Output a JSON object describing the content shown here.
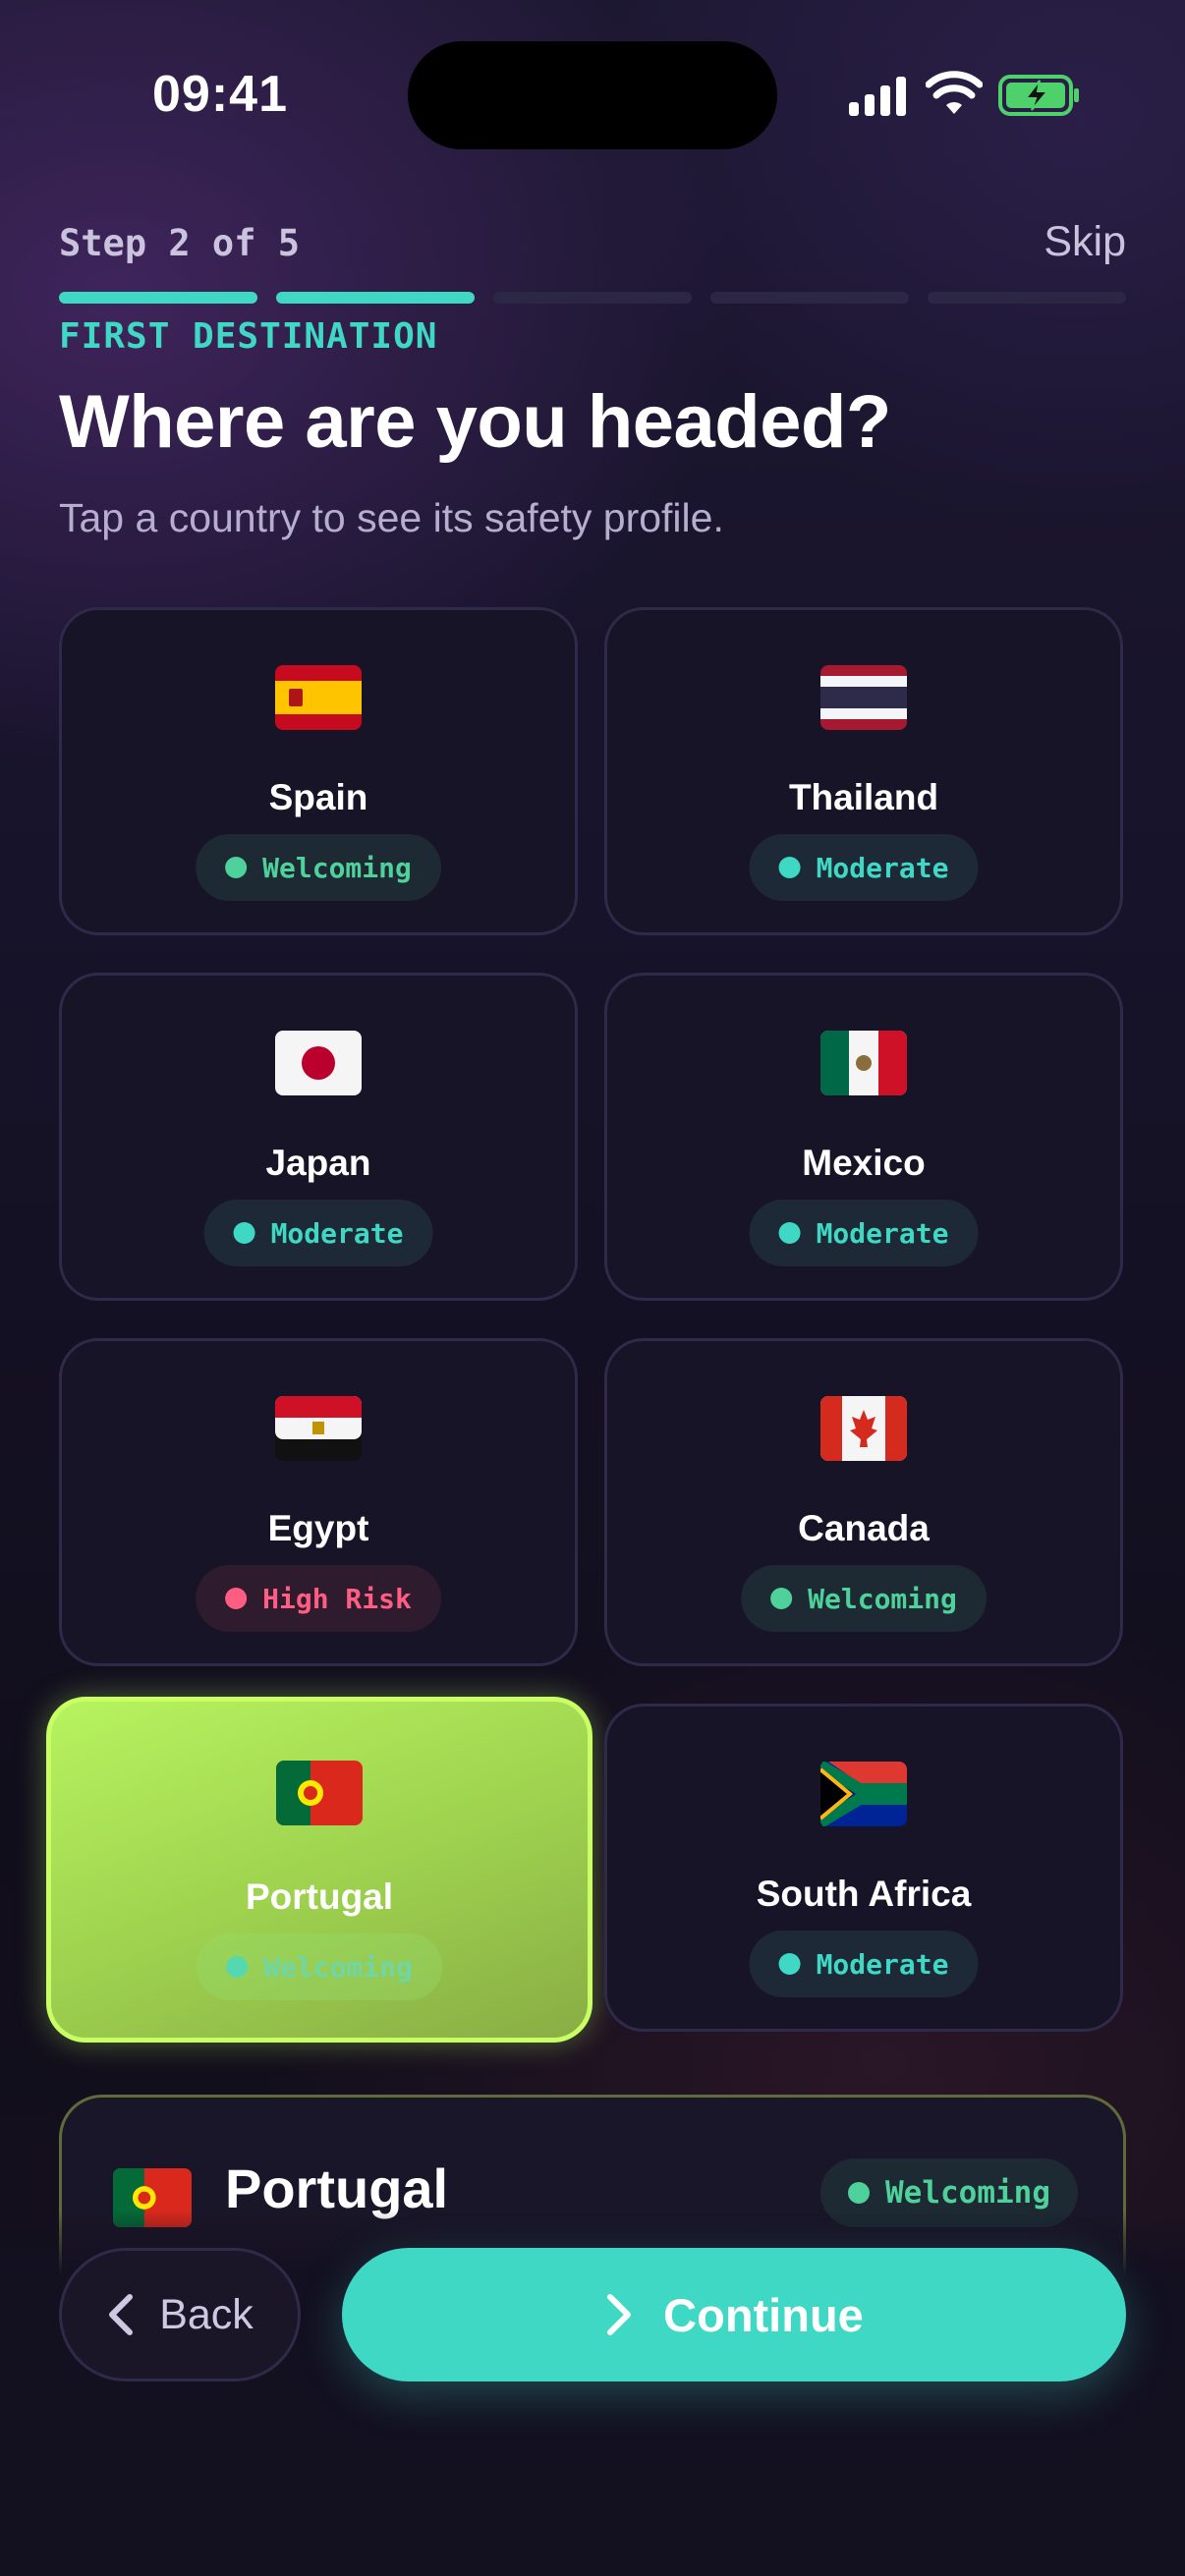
{
  "status_bar": {
    "time": "09:41"
  },
  "header": {
    "step_text": "Step 2 of 5",
    "skip_label": "Skip",
    "progress": {
      "current": 2,
      "total": 5
    }
  },
  "intro": {
    "eyebrow": "FIRST DESTINATION",
    "title": "Where are you headed?",
    "subtitle": "Tap a country to see its safety profile."
  },
  "countries": [
    {
      "name": "Spain",
      "flag": "spain-flag-icon",
      "status": "Welcoming",
      "level": "welcoming",
      "selected": false
    },
    {
      "name": "Thailand",
      "flag": "thailand-flag-icon",
      "status": "Moderate",
      "level": "moderate",
      "selected": false
    },
    {
      "name": "Japan",
      "flag": "japan-flag-icon",
      "status": "Moderate",
      "level": "moderate",
      "selected": false
    },
    {
      "name": "Mexico",
      "flag": "mexico-flag-icon",
      "status": "Moderate",
      "level": "moderate",
      "selected": false
    },
    {
      "name": "Egypt",
      "flag": "egypt-flag-icon",
      "status": "High Risk",
      "level": "high",
      "selected": false
    },
    {
      "name": "Canada",
      "flag": "canada-flag-icon",
      "status": "Welcoming",
      "level": "welcoming",
      "selected": false
    },
    {
      "name": "Portugal",
      "flag": "portugal-flag-icon",
      "status": "Welcoming",
      "level": "welcoming",
      "selected": true
    },
    {
      "name": "South Africa",
      "flag": "south-africa-flag-icon",
      "status": "Moderate",
      "level": "moderate",
      "selected": false
    }
  ],
  "detail": {
    "name": "Portugal",
    "status": "Welcoming"
  },
  "footer": {
    "back_label": "Back",
    "continue_label": "Continue"
  },
  "colors": {
    "accent": "#3fd8c5",
    "selected": "#b7f35f",
    "welcoming": "#4ed19a",
    "high_risk": "#ff5d82"
  }
}
